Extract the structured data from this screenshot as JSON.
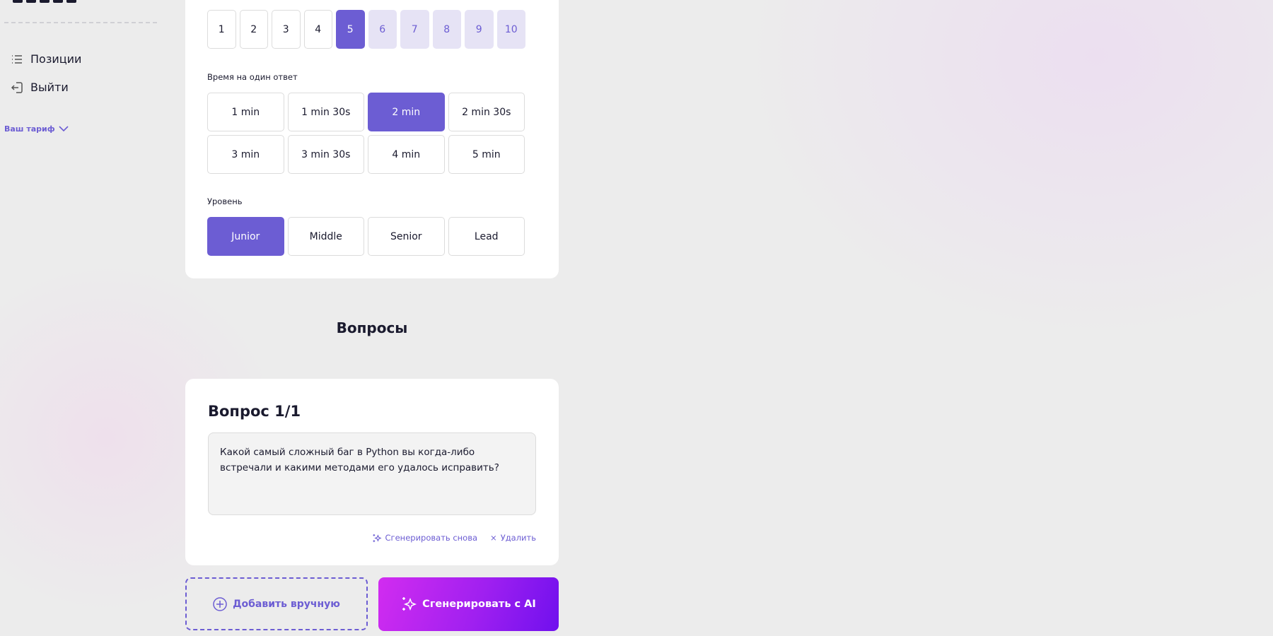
{
  "sidebar": {
    "items": [
      {
        "label": "Позиции",
        "icon": "list-icon"
      },
      {
        "label": "Выйти",
        "icon": "logout-icon"
      }
    ],
    "tariff": "Ваш тариф"
  },
  "settings": {
    "count_options": [
      "1",
      "2",
      "3",
      "4",
      "5",
      "6",
      "7",
      "8",
      "9",
      "10"
    ],
    "count_selected": "5",
    "time_label": "Время на один ответ",
    "time_options": [
      "1 min",
      "1 min 30s",
      "2 min",
      "2 min 30s",
      "3 min",
      "3 min 30s",
      "4 min",
      "5 min"
    ],
    "time_selected": "2 min",
    "level_label": "Уровень",
    "level_options": [
      "Junior",
      "Middle",
      "Senior",
      "Lead"
    ],
    "level_selected": "Junior"
  },
  "questions": {
    "heading": "Вопросы",
    "items": [
      {
        "title": "Вопрос 1/1",
        "text": "Какой самый сложный баг в Python вы когда-либо встречали и какими методами его удалось исправить?"
      }
    ],
    "regenerate": "Сгенерировать снова",
    "delete": "Удалить",
    "add_manual": "Добавить вручную",
    "generate_ai": "Сгенерировать с AI"
  },
  "colors": {
    "accent": "#6c5dd3",
    "accent_light": "#e6e3f5",
    "gradient_start": "#d22cf0",
    "gradient_end": "#7010ee"
  }
}
